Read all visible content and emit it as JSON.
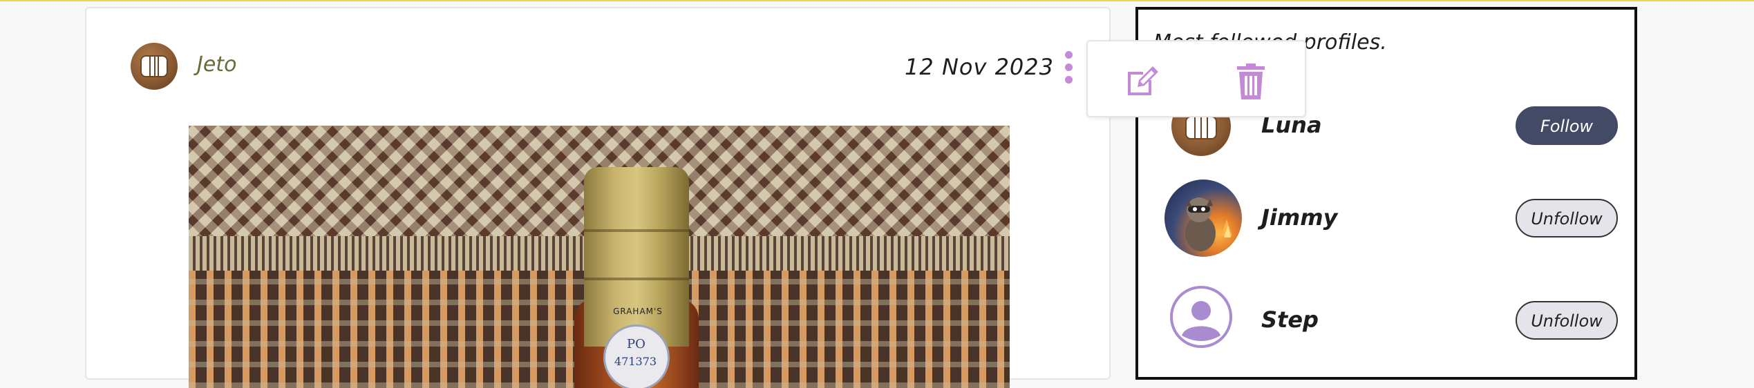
{
  "post": {
    "author": "Jeto",
    "date": "12 Nov 2023",
    "image_label": "GRAHAM'S",
    "seal_po": "PO",
    "seal_code": "471373"
  },
  "actions": {
    "edit_icon": "edit-icon",
    "delete_icon": "trash-icon"
  },
  "sidebar": {
    "title": "Most followed profiles.",
    "profiles": [
      {
        "name": "Luna",
        "button": "Follow"
      },
      {
        "name": "Jimmy",
        "button": "Unfollow"
      },
      {
        "name": "Step",
        "button": "Unfollow"
      }
    ]
  },
  "colors": {
    "accent": "#c48ad6",
    "follow_button": "#424a66",
    "top_border": "#e8d84a"
  }
}
